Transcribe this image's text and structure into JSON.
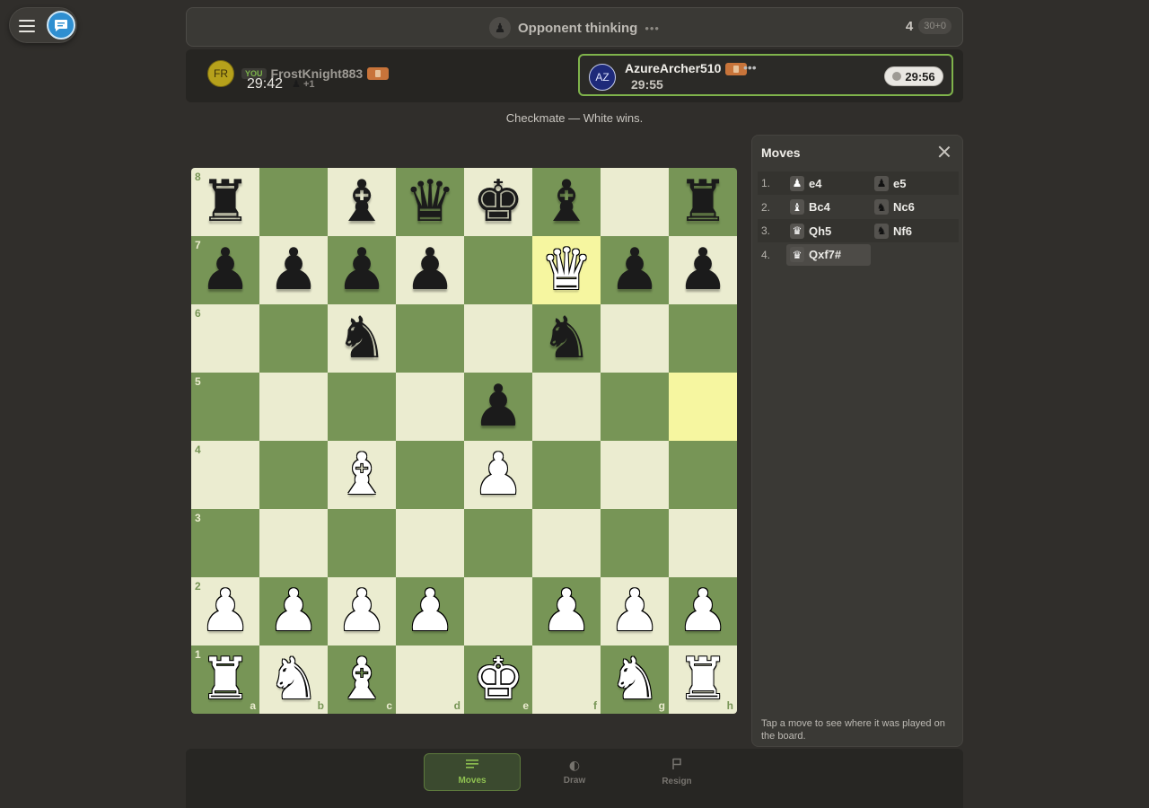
{
  "status": {
    "text": "Opponent thinking",
    "dots": "•••",
    "move_number": "4",
    "time_control": "30+0"
  },
  "player_you": {
    "initials": "FR",
    "badge": "YOU",
    "name": "FrostKnight883",
    "time": "29:42",
    "material": "+1",
    "captured_icon": "♟"
  },
  "player_opponent": {
    "initials": "AZ",
    "name": "AzureArcher510",
    "more": "•••",
    "time": "29:55",
    "clock": "29:56"
  },
  "result": "Checkmate — White wins.",
  "board": {
    "ranks": [
      "8",
      "7",
      "6",
      "5",
      "4",
      "3",
      "2",
      "1"
    ],
    "files": [
      "a",
      "b",
      "c",
      "d",
      "e",
      "f",
      "g",
      "h"
    ],
    "highlight": [
      "f7",
      "h5"
    ],
    "position": [
      [
        "br",
        "",
        "bb",
        "bq",
        "bk",
        "bb",
        "",
        "br"
      ],
      [
        "bp",
        "bp",
        "bp",
        "bp",
        "",
        "wq",
        "bp",
        "bp"
      ],
      [
        "",
        "",
        "bn",
        "",
        "",
        "bn",
        "",
        ""
      ],
      [
        "",
        "",
        "",
        "",
        "bp",
        "",
        "",
        ""
      ],
      [
        "",
        "",
        "wb",
        "",
        "wp",
        "",
        "",
        ""
      ],
      [
        "",
        "",
        "",
        "",
        "",
        "",
        "",
        ""
      ],
      [
        "wp",
        "wp",
        "wp",
        "wp",
        "",
        "wp",
        "wp",
        "wp"
      ],
      [
        "wr",
        "wn",
        "wb",
        "",
        "wk",
        "",
        "wn",
        "wr"
      ]
    ]
  },
  "moves_panel": {
    "title": "Moves",
    "moves": [
      {
        "num": "1.",
        "white": "e4",
        "white_icon": "wp",
        "black": "e5",
        "black_icon": "bp"
      },
      {
        "num": "2.",
        "white": "Bc4",
        "white_icon": "wb",
        "black": "Nc6",
        "black_icon": "bn"
      },
      {
        "num": "3.",
        "white": "Qh5",
        "white_icon": "wq",
        "black": "Nf6",
        "black_icon": "bn"
      },
      {
        "num": "4.",
        "white": "Qxf7#",
        "white_icon": "wq",
        "black": "",
        "black_icon": ""
      }
    ],
    "active_move": "Qxf7#",
    "hint": "Tap a move to see where it was played on the board."
  },
  "toolbar": {
    "moves_label": "Moves",
    "draw_label": "Draw",
    "resign_label": "Resign",
    "moves_icon": "list-icon",
    "draw_icon": "half-circle-icon",
    "resign_icon": "flag-icon"
  },
  "colors": {
    "light_square": "#ebecd0",
    "dark_square": "#779556",
    "highlight": "#f6f6a0",
    "accent_green": "#7fb34b"
  }
}
